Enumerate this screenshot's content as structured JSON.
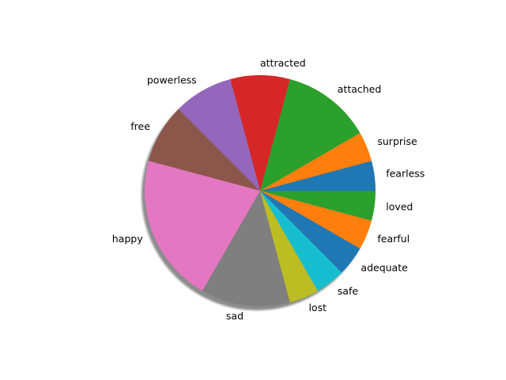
{
  "chart_data": {
    "type": "pie",
    "title": "",
    "shadow": true,
    "start_angle_deg": 0,
    "direction": "counterclockwise",
    "slices": [
      {
        "label": "fearless",
        "value": 1,
        "color": "#1f77b4"
      },
      {
        "label": "surprise",
        "value": 1,
        "color": "#ff7f0e"
      },
      {
        "label": "attached",
        "value": 3,
        "color": "#2ca02c"
      },
      {
        "label": "attracted",
        "value": 2,
        "color": "#d62728"
      },
      {
        "label": "powerless",
        "value": 2,
        "color": "#9467bd"
      },
      {
        "label": "free",
        "value": 2,
        "color": "#8c564b"
      },
      {
        "label": "happy",
        "value": 5,
        "color": "#e377c2"
      },
      {
        "label": "sad",
        "value": 3,
        "color": "#7f7f7f"
      },
      {
        "label": "lost",
        "value": 1,
        "color": "#bcbd22"
      },
      {
        "label": "safe",
        "value": 1,
        "color": "#17becf"
      },
      {
        "label": "adequate",
        "value": 1,
        "color": "#1f77b4"
      },
      {
        "label": "fearful",
        "value": 1,
        "color": "#ff7f0e"
      },
      {
        "label": "loved",
        "value": 1,
        "color": "#2ca02c"
      }
    ]
  }
}
